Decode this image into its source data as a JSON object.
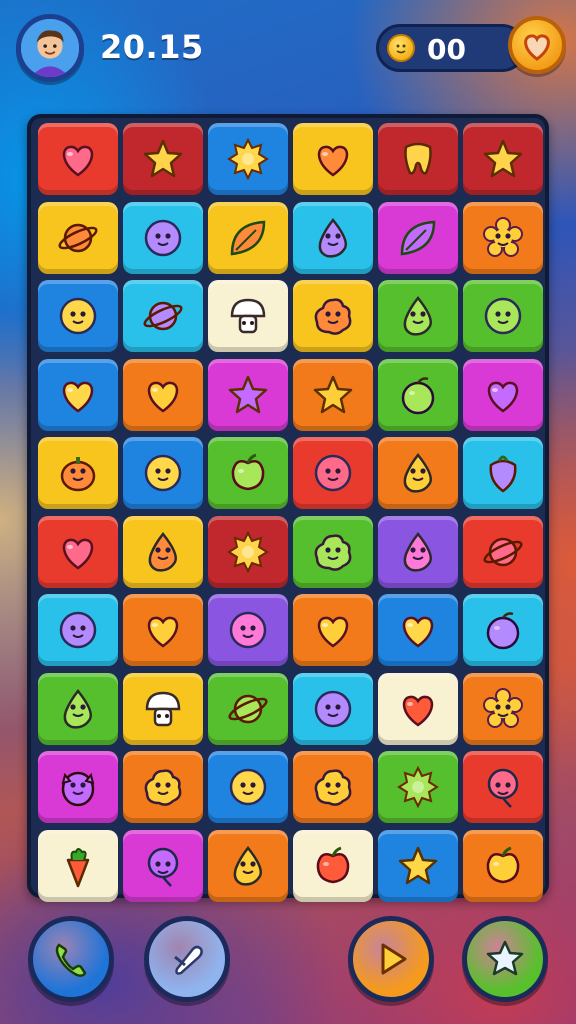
{
  "hud": {
    "score": "20.15",
    "coins": "00",
    "avatar_icon": "player-avatar",
    "coin_icon": "coin-icon",
    "heart_icon": "heart-icon"
  },
  "palette": {
    "red": "#e83b2e",
    "darkred": "#c0282d",
    "blue": "#1f83e0",
    "yellow": "#f7c51e",
    "orange": "#f27a1a",
    "green": "#56bf2e",
    "cyan": "#29c1ea",
    "magenta": "#d93ad6",
    "purple": "#8a55e0",
    "cream": "#f8f1d2"
  },
  "board": {
    "rows": 10,
    "cols": 6,
    "tiles": [
      [
        {
          "c": "red",
          "i": "heart"
        },
        {
          "c": "darkred",
          "i": "star"
        },
        {
          "c": "blue",
          "i": "burst"
        },
        {
          "c": "yellow",
          "i": "heart"
        },
        {
          "c": "darkred",
          "i": "tooth"
        },
        {
          "c": "darkred",
          "i": "star"
        }
      ],
      [
        {
          "c": "yellow",
          "i": "planet"
        },
        {
          "c": "cyan",
          "i": "face"
        },
        {
          "c": "yellow",
          "i": "leaf"
        },
        {
          "c": "cyan",
          "i": "drop"
        },
        {
          "c": "magenta",
          "i": "leaf"
        },
        {
          "c": "orange",
          "i": "flower"
        }
      ],
      [
        {
          "c": "blue",
          "i": "face"
        },
        {
          "c": "cyan",
          "i": "planet"
        },
        {
          "c": "cream",
          "i": "mushroom"
        },
        {
          "c": "yellow",
          "i": "blob"
        },
        {
          "c": "green",
          "i": "drop"
        },
        {
          "c": "green",
          "i": "face"
        }
      ],
      [
        {
          "c": "blue",
          "i": "heart"
        },
        {
          "c": "orange",
          "i": "heart"
        },
        {
          "c": "magenta",
          "i": "star"
        },
        {
          "c": "orange",
          "i": "star"
        },
        {
          "c": "green",
          "i": "plum"
        },
        {
          "c": "magenta",
          "i": "heart"
        }
      ],
      [
        {
          "c": "yellow",
          "i": "pumpkin"
        },
        {
          "c": "blue",
          "i": "face"
        },
        {
          "c": "green",
          "i": "apple"
        },
        {
          "c": "red",
          "i": "face"
        },
        {
          "c": "orange",
          "i": "drop"
        },
        {
          "c": "cyan",
          "i": "pepper"
        }
      ],
      [
        {
          "c": "red",
          "i": "heart"
        },
        {
          "c": "yellow",
          "i": "drop"
        },
        {
          "c": "darkred",
          "i": "burst"
        },
        {
          "c": "green",
          "i": "blob"
        },
        {
          "c": "purple",
          "i": "drop"
        },
        {
          "c": "red",
          "i": "planet"
        }
      ],
      [
        {
          "c": "cyan",
          "i": "face"
        },
        {
          "c": "orange",
          "i": "heart"
        },
        {
          "c": "purple",
          "i": "face"
        },
        {
          "c": "orange",
          "i": "heart"
        },
        {
          "c": "blue",
          "i": "heart"
        },
        {
          "c": "cyan",
          "i": "plum"
        }
      ],
      [
        {
          "c": "green",
          "i": "drop"
        },
        {
          "c": "yellow",
          "i": "mushroom"
        },
        {
          "c": "green",
          "i": "planet"
        },
        {
          "c": "cyan",
          "i": "face"
        },
        {
          "c": "cream",
          "i": "heart"
        },
        {
          "c": "orange",
          "i": "flower"
        }
      ],
      [
        {
          "c": "magenta",
          "i": "owl"
        },
        {
          "c": "orange",
          "i": "blob"
        },
        {
          "c": "blue",
          "i": "face"
        },
        {
          "c": "orange",
          "i": "blob"
        },
        {
          "c": "green",
          "i": "burst"
        },
        {
          "c": "red",
          "i": "balloon"
        }
      ],
      [
        {
          "c": "cream",
          "i": "carrot"
        },
        {
          "c": "magenta",
          "i": "balloon"
        },
        {
          "c": "orange",
          "i": "drop"
        },
        {
          "c": "cream",
          "i": "apple"
        },
        {
          "c": "blue",
          "i": "star"
        },
        {
          "c": "orange",
          "i": "apple"
        }
      ]
    ]
  },
  "bottom_buttons": [
    {
      "name": "phone-button",
      "icon": "phone-icon",
      "bg": "#1f74d8"
    },
    {
      "name": "wand-button",
      "icon": "wand-icon",
      "bg": "#8fb4ee"
    },
    {
      "name": "play-button",
      "icon": "play-icon",
      "bg": "#f59a1c"
    },
    {
      "name": "star-button",
      "icon": "star-icon",
      "bg": "#57c02c"
    }
  ]
}
